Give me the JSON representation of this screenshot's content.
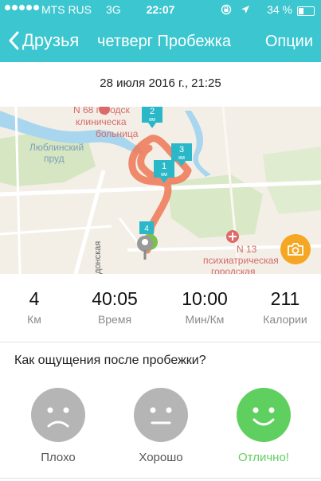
{
  "status_bar": {
    "carrier": "MTS RUS",
    "network": "3G",
    "time": "22:07",
    "battery": "34 %",
    "battery_level": 0.34
  },
  "nav": {
    "back_label": "Друзья",
    "title": "четверг Пробежка",
    "options_label": "Опции"
  },
  "run_date": "28 июля 2016 г., 21:25",
  "map": {
    "labels": {
      "hospital_68_line1": "N 68 городск",
      "hospital_68_line2": "клиническа",
      "hospital_68_line3": "больница",
      "pond_line1": "Люблинский",
      "pond_line2": "пруд",
      "hospital_13_line1": "N 13",
      "hospital_13_line2": "психиатрическая",
      "hospital_13_line3": "городская",
      "street": "донская"
    },
    "km_markers": [
      {
        "num": "1",
        "unit": "км"
      },
      {
        "num": "2",
        "unit": "км"
      },
      {
        "num": "3",
        "unit": "км"
      },
      {
        "num": "4",
        "unit": ""
      }
    ],
    "route_color": "#ee7755",
    "marker_color": "#2ab7c8",
    "camera_color": "#f5a623"
  },
  "stats": [
    {
      "value": "4",
      "label": "Км"
    },
    {
      "value": "40:05",
      "label": "Время"
    },
    {
      "value": "10:00",
      "label": "Мин/Км"
    },
    {
      "value": "211",
      "label": "Калории"
    }
  ],
  "feeling": {
    "question": "Как ощущения после пробежки?",
    "options": [
      {
        "label": "Плохо",
        "icon": "sad-face-icon",
        "selected": false
      },
      {
        "label": "Хорошо",
        "icon": "neutral-face-icon",
        "selected": false
      },
      {
        "label": "Отлично!",
        "icon": "happy-face-icon",
        "selected": true
      }
    ]
  },
  "colors": {
    "accent": "#3cc6cf",
    "selected": "#5fd05f",
    "unselected": "#b5b5b5"
  }
}
